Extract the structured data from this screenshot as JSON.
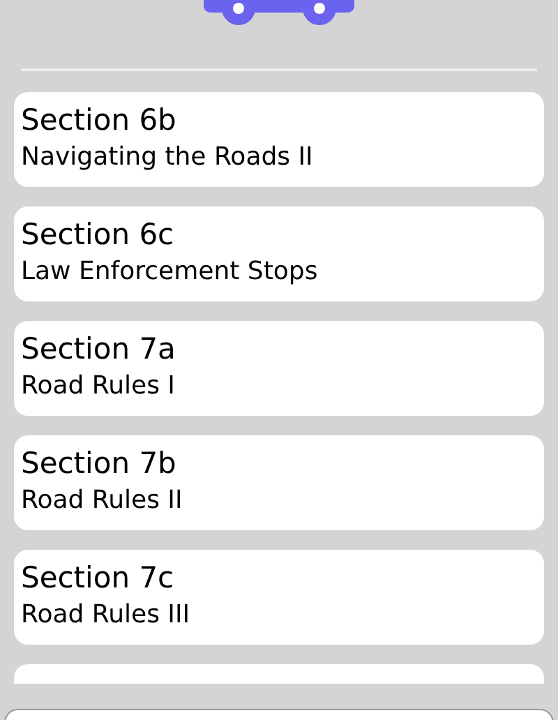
{
  "sections": [
    {
      "title": "Section 6b",
      "subtitle": "Navigating the Roads II"
    },
    {
      "title": "Section 6c",
      "subtitle": "Law Enforcement Stops"
    },
    {
      "title": "Section 7a",
      "subtitle": "Road Rules I"
    },
    {
      "title": "Section 7b",
      "subtitle": "Road Rules II"
    },
    {
      "title": "Section 7c",
      "subtitle": "Road Rules III"
    }
  ]
}
